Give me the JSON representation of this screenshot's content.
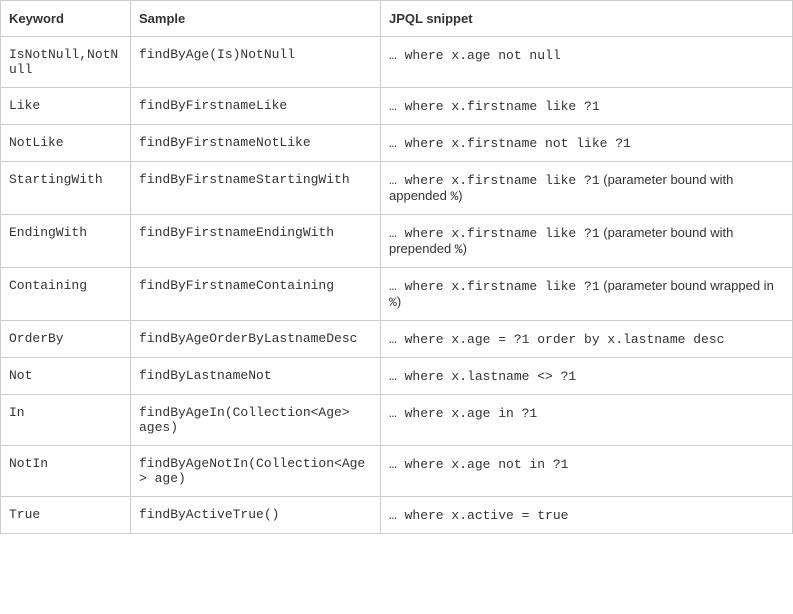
{
  "chart_data": {
    "type": "table",
    "headers": [
      "Keyword",
      "Sample",
      "JPQL snippet"
    ],
    "rows": [
      {
        "keyword": "IsNotNull,NotNull",
        "sample": "findByAge(Is)NotNull",
        "snippet_code": "… where x.age not null",
        "snippet_note": ""
      },
      {
        "keyword": "Like",
        "sample": "findByFirstnameLike",
        "snippet_code": "… where x.firstname like ?1",
        "snippet_note": ""
      },
      {
        "keyword": "NotLike",
        "sample": "findByFirstnameNotLike",
        "snippet_code": "… where x.firstname not like ?1",
        "snippet_note": ""
      },
      {
        "keyword": "StartingWith",
        "sample": "findByFirstnameStartingWith",
        "snippet_code": "… where x.firstname like ?1",
        "snippet_note": " (parameter bound with appended %)"
      },
      {
        "keyword": "EndingWith",
        "sample": "findByFirstnameEndingWith",
        "snippet_code": "… where x.firstname like ?1",
        "snippet_note": " (parameter bound with prepended %)"
      },
      {
        "keyword": "Containing",
        "sample": "findByFirstnameContaining",
        "snippet_code": "… where x.firstname like ?1",
        "snippet_note": " (parameter bound wrapped in %)"
      },
      {
        "keyword": "OrderBy",
        "sample": "findByAgeOrderByLastnameDesc",
        "snippet_code": "… where x.age = ?1 order by x.lastname desc",
        "snippet_note": ""
      },
      {
        "keyword": "Not",
        "sample": "findByLastnameNot",
        "snippet_code": "… where x.lastname <> ?1",
        "snippet_note": ""
      },
      {
        "keyword": "In",
        "sample": "findByAgeIn(Collection<Age> ages)",
        "snippet_code": "… where x.age in ?1",
        "snippet_note": ""
      },
      {
        "keyword": "NotIn",
        "sample": "findByAgeNotIn(Collection<Age> age)",
        "snippet_code": "… where x.age not in ?1",
        "snippet_note": ""
      },
      {
        "keyword": "True",
        "sample": "findByActiveTrue()",
        "snippet_code": "… where x.active = true",
        "snippet_note": ""
      }
    ]
  }
}
